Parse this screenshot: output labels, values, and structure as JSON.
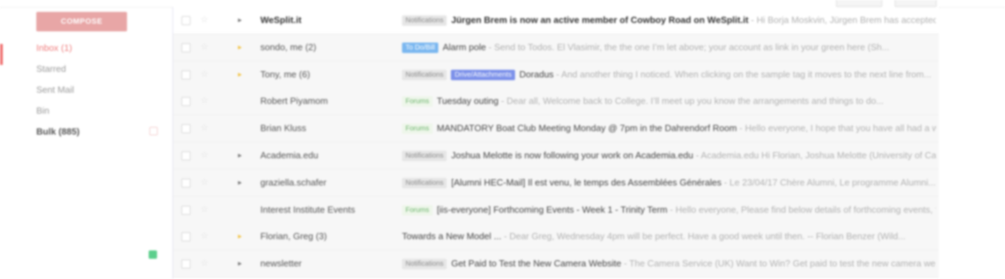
{
  "sidebar": {
    "compose_label": "COMPOSE",
    "nav": [
      {
        "label": "Inbox (1)",
        "state": "active"
      },
      {
        "label": "Starred",
        "state": "normal"
      },
      {
        "label": "Sent Mail",
        "state": "normal"
      },
      {
        "label": "Bin",
        "state": "normal"
      },
      {
        "label": "Bulk (885)",
        "state": "bold"
      }
    ]
  },
  "messages": [
    {
      "unread": true,
      "star": false,
      "importance": "dark",
      "sender": "WeSplit.it",
      "tags": [
        {
          "text": "Notifications",
          "style": "notif"
        }
      ],
      "subject": "Jürgen Brem is now an active member of Cowboy Road on WeSplit.it",
      "snippet": " - Hi Borja Moskvin, Jürgen Brem has accepted..."
    },
    {
      "unread": false,
      "star": false,
      "importance": "yellow",
      "sender": "sondo, me (2)",
      "tags": [
        {
          "text": "To Do/Bill",
          "style": "blue"
        }
      ],
      "subject": "Alarm pole",
      "snippet": " - Send to Todos. El Vlasimir, the the one I’m let above; your account as link in your green here (Sh..."
    },
    {
      "unread": false,
      "star": false,
      "importance": "yellow",
      "sender": "Tony, me (6)",
      "tags": [
        {
          "text": "Notifications",
          "style": "notif"
        },
        {
          "text": "Drive/Attachments",
          "style": "purple"
        }
      ],
      "subject": "Doradus",
      "snippet": " - And another thing I noticed. When clicking on the sample tag it moves to the next line from..."
    },
    {
      "unread": false,
      "star": false,
      "importance": "none",
      "sender": "Robert Piyamom",
      "tags": [
        {
          "text": "Forums",
          "style": "green"
        }
      ],
      "subject": "Tuesday outing",
      "snippet": " - Dear all, Welcome back to College. I’ll meet up you know the arrangements and things to do..."
    },
    {
      "unread": false,
      "star": false,
      "importance": "none",
      "sender": "Brian Kluss",
      "tags": [
        {
          "text": "Forums",
          "style": "green"
        }
      ],
      "subject": "MANDATORY Boat Club Meeting Monday @ 7pm in the Dahrendorf Room",
      "snippet": " - Hello everyone, I hope that you have all had a wonderful..."
    },
    {
      "unread": false,
      "star": false,
      "importance": "dark",
      "sender": "Academia.edu",
      "tags": [
        {
          "text": "Notifications",
          "style": "notif"
        }
      ],
      "subject": "Joshua Melotte is now following your work on Academia.edu",
      "snippet": " - Academia.edu Hi Florian, Joshua Melotte (University of Cambr..."
    },
    {
      "unread": false,
      "star": false,
      "importance": "dark",
      "sender": "graziella.schafer",
      "tags": [
        {
          "text": "Notifications",
          "style": "notif"
        }
      ],
      "subject": "[Alumni HEC-Mail] Il est venu, le temps des Assemblées Générales",
      "snippet": " - Le 23/04/17 Chère Alumni, Le programme Alumni..."
    },
    {
      "unread": false,
      "star": false,
      "importance": "none",
      "sender": "Interest Institute Events",
      "tags": [
        {
          "text": "Forums",
          "style": "green"
        }
      ],
      "subject": "[iis-everyone] Forthcoming Events - Week 1 - Trinity Term",
      "snippet": " - Hello everyone, Please find below details of forthcoming events, this..."
    },
    {
      "unread": false,
      "star": false,
      "importance": "yellow",
      "sender": "Florian, Greg (3)",
      "tags": [],
      "subject": "Towards a New Model ...",
      "snippet": " - Dear Greg, Wednesday 4pm will be perfect. Have a good week until then. -- Florian Benzer (Wild..."
    },
    {
      "unread": false,
      "star": false,
      "importance": "dark",
      "sender": "newsletter",
      "tags": [
        {
          "text": "Notifications",
          "style": "notif"
        }
      ],
      "subject": "Get Paid to Test the New Camera Website",
      "snippet": " - The Camera Service (UK) Want to Win? Get paid to test the new camera website. Sign up..."
    }
  ]
}
